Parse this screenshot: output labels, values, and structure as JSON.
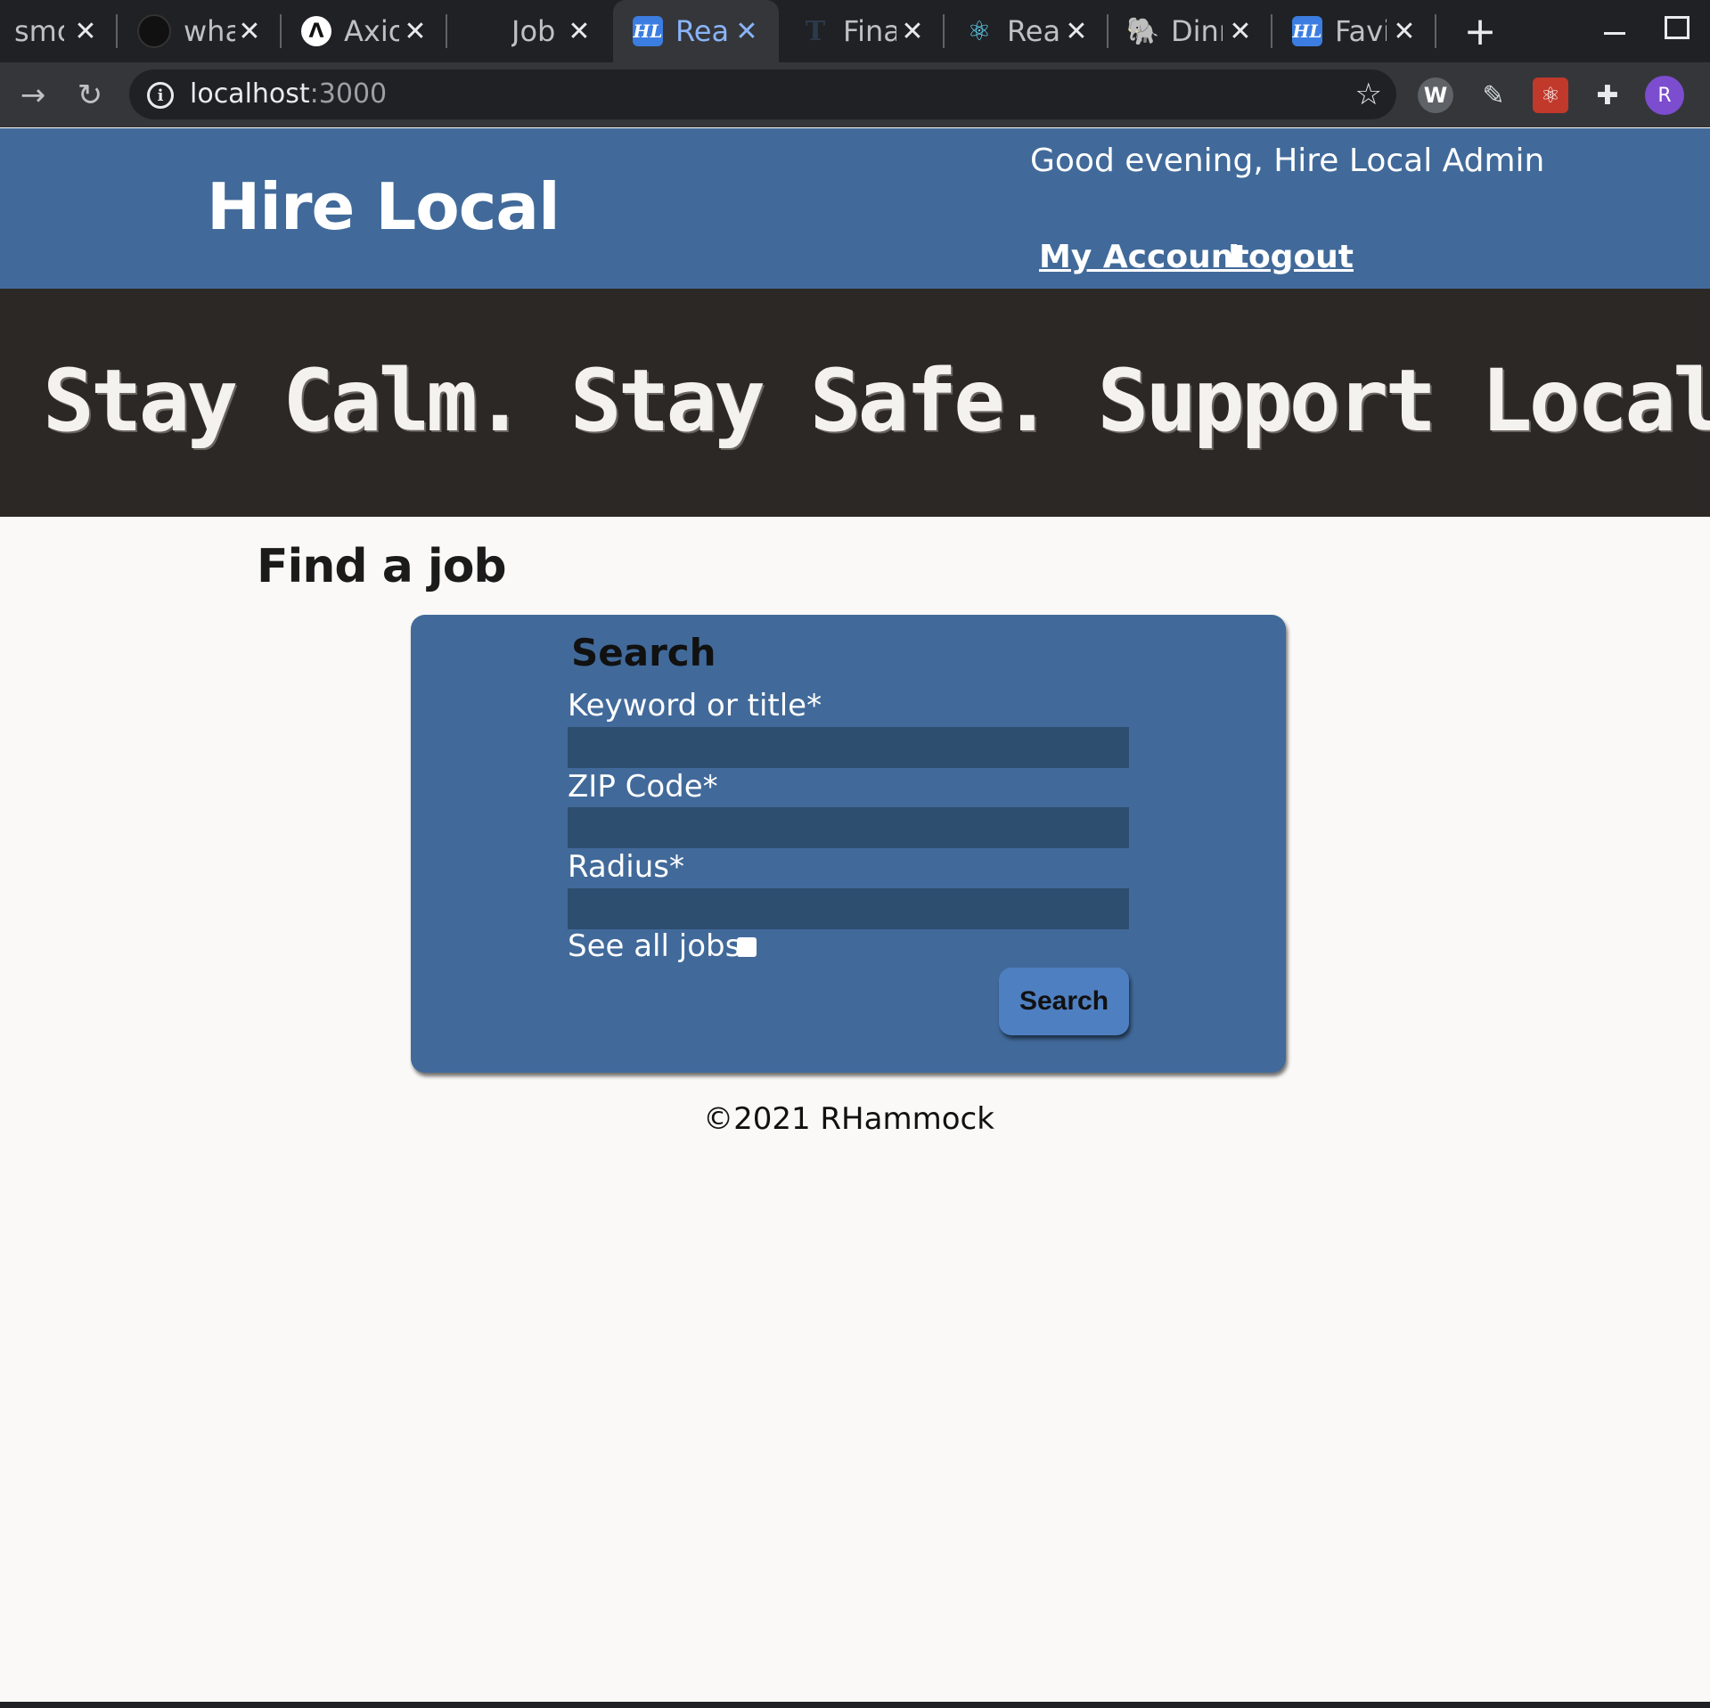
{
  "browser": {
    "tabs": [
      {
        "title": "smo",
        "icon": "none",
        "active": false
      },
      {
        "title": "wha",
        "icon": "github-icon",
        "active": false
      },
      {
        "title": "Axio",
        "icon": "axios-icon",
        "active": false
      },
      {
        "title": "Job",
        "icon": "none",
        "active": false
      },
      {
        "title": "Rea",
        "icon": "hire-local-icon",
        "active": true
      },
      {
        "title": "Fina",
        "icon": "t-icon",
        "active": false
      },
      {
        "title": "Rea",
        "icon": "react-icon",
        "active": false
      },
      {
        "title": "Dinr",
        "icon": "postgres-elephant-icon",
        "active": false
      },
      {
        "title": "Favi",
        "icon": "hire-local-icon",
        "active": false
      }
    ],
    "favicon_glyphs": {
      "hl": "HL",
      "react": "⚛",
      "elephant": "🐘",
      "t": "T",
      "axios": "Λ"
    },
    "close_glyph": "✕",
    "new_tab_glyph": "+",
    "omnibox": {
      "host": "localhost",
      "port": ":3000",
      "info_glyph": "i",
      "star_glyph": "☆"
    },
    "nav": {
      "forward_glyph": "→",
      "reload_glyph": "↻"
    },
    "extensions": {
      "w_glyph": "W",
      "pen_glyph": "✎",
      "redux_glyph": "⚛",
      "puzzle_glyph": "✚",
      "avatar_letter": "R"
    },
    "colors": {
      "active_tab_text": "#8ab4f8",
      "chrome_dark": "#202124",
      "toolbar": "#35363a"
    }
  },
  "header": {
    "brand": "Hire Local",
    "greeting": "Good evening, Hire Local Admin",
    "links": {
      "account": "My Account",
      "logout": "Logout"
    },
    "color": "#416a9a"
  },
  "banner": {
    "text": "Stay Calm. Stay Safe. Support Local."
  },
  "main": {
    "title": "Find a job",
    "search": {
      "heading": "Search",
      "fields": {
        "keyword": {
          "label": "Keyword or title*",
          "value": ""
        },
        "zip": {
          "label": "ZIP Code*",
          "value": ""
        },
        "radius": {
          "label": "Radius*",
          "value": ""
        }
      },
      "see_all_label": "See all jobs",
      "see_all_checked": false,
      "submit_label": "Search"
    }
  },
  "footer": {
    "text": "©2021 RHammock"
  }
}
